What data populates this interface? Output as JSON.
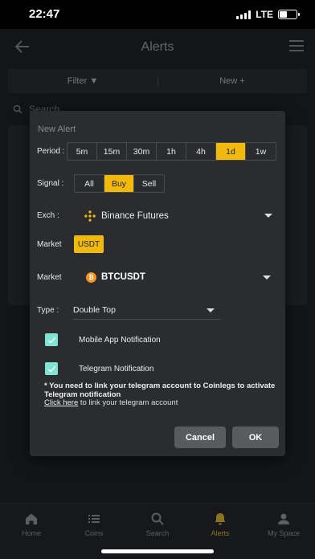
{
  "status_bar": {
    "time": "22:47",
    "network": "LTE"
  },
  "header": {
    "title": "Alerts"
  },
  "toolbar": {
    "filter_label": "Filter",
    "new_label": "New"
  },
  "search": {
    "placeholder": "Search"
  },
  "modal": {
    "title": "New Alert",
    "period": {
      "label": "Period :",
      "options": [
        "5m",
        "15m",
        "30m",
        "1h",
        "4h",
        "1d",
        "1w"
      ],
      "selected": "1d"
    },
    "signal": {
      "label": "Signal :",
      "options": [
        "All",
        "Buy",
        "Sell"
      ],
      "selected": "Buy"
    },
    "exchange": {
      "label": "Exch :",
      "value": "Binance Futures"
    },
    "market_quote": {
      "label": "Market",
      "value": "USDT"
    },
    "market_pair": {
      "label": "Market",
      "value": "BTCUSDT"
    },
    "type": {
      "label": "Type :",
      "value": "Double Top"
    },
    "notifications": [
      {
        "label": "Mobile App Notification",
        "checked": true
      },
      {
        "label": "Telegram Notification",
        "checked": true
      }
    ],
    "note": "* You need to link your telegram account to Coinlegs to activate Telegram notification",
    "link_text": "Click here",
    "link_suffix": " to link your telegram account",
    "cancel_label": "Cancel",
    "ok_label": "OK"
  },
  "colors": {
    "accent": "#f0b90b",
    "checkbox": "#7fe3d1",
    "bitcoin": "#f7931a"
  },
  "bottom_nav": [
    {
      "label": "Home",
      "icon": "home-icon"
    },
    {
      "label": "Coins",
      "icon": "list-icon"
    },
    {
      "label": "Search",
      "icon": "search-icon"
    },
    {
      "label": "Alerts",
      "icon": "bell-icon",
      "active": true
    },
    {
      "label": "My Space",
      "icon": "user-icon"
    }
  ]
}
